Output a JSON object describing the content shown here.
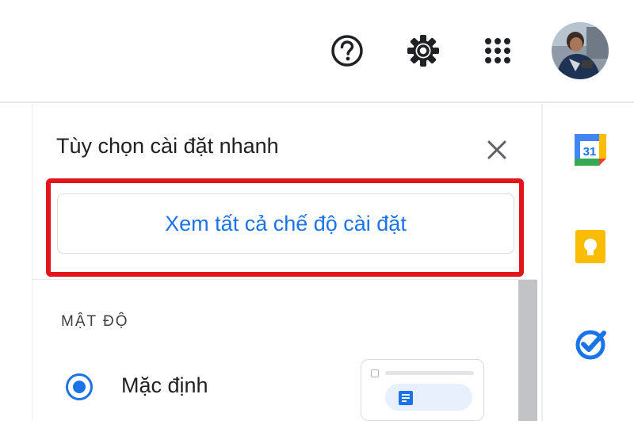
{
  "quick_settings": {
    "title": "Tùy chọn cài đặt nhanh",
    "see_all_label": "Xem tất cả chế độ cài đặt",
    "density": {
      "section_label": "MẬT ĐỘ",
      "options": [
        {
          "label": "Mặc định",
          "selected": true
        }
      ]
    }
  },
  "side_apps": {
    "calendar_day": "31"
  },
  "colors": {
    "accent": "#1a73e8",
    "highlight": "#e3151c",
    "icon_gray": "#5f6368"
  },
  "icons": [
    "help-icon",
    "settings-gear-icon",
    "apps-grid-icon",
    "avatar",
    "close-icon",
    "calendar-icon",
    "keep-icon",
    "tasks-icon"
  ]
}
